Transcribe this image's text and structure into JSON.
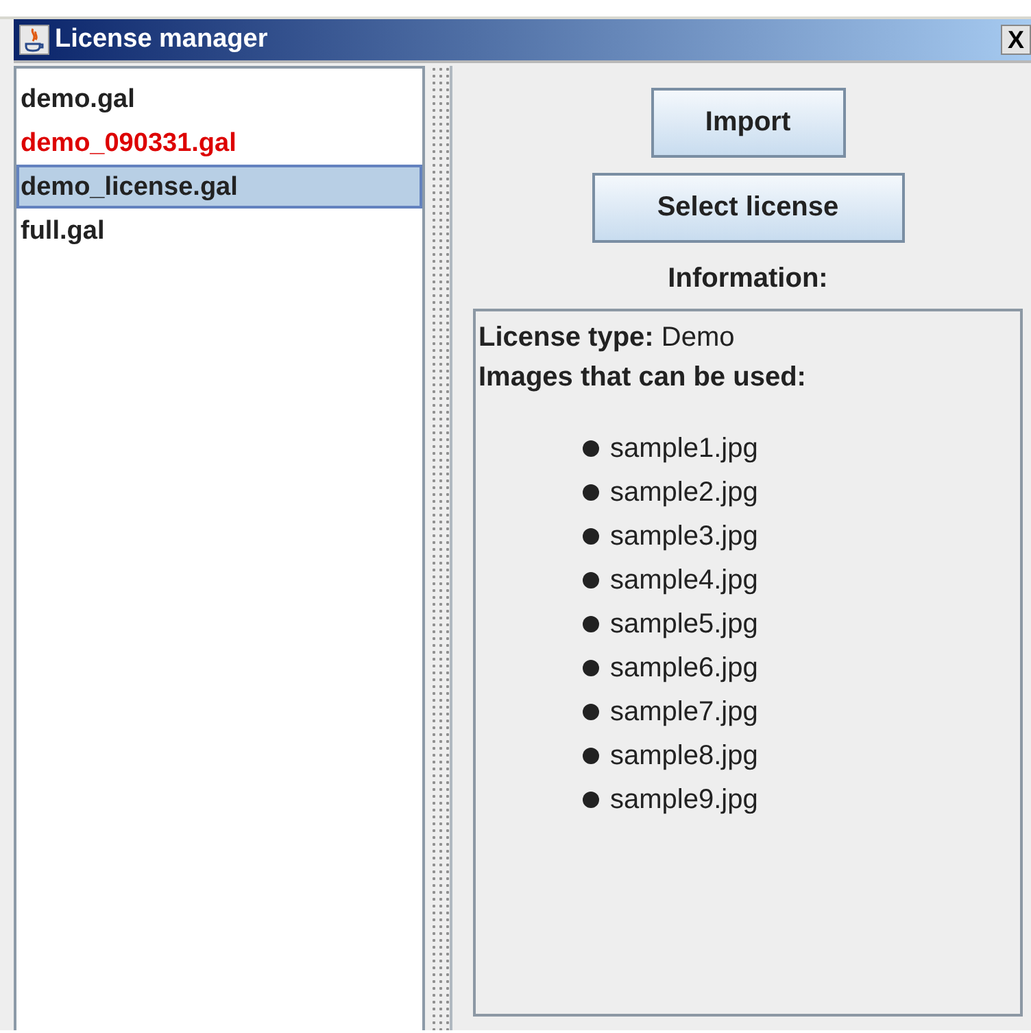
{
  "window": {
    "title": "License manager",
    "close": "X"
  },
  "files": [
    {
      "name": "demo.gal",
      "selected": false,
      "color": "#222222"
    },
    {
      "name": "demo_090331.gal",
      "selected": false,
      "color": "#dd0000"
    },
    {
      "name": "demo_license.gal",
      "selected": true,
      "color": "#222222"
    },
    {
      "name": "full.gal",
      "selected": false,
      "color": "#222222"
    }
  ],
  "buttons": [
    "Import",
    "Select license"
  ],
  "information": {
    "heading": "Information:",
    "license_type_label": "License type:",
    "license_type": "Demo",
    "images_label": "Images that can be used:",
    "images": [
      "sample1.jpg",
      "sample2.jpg",
      "sample3.jpg",
      "sample4.jpg",
      "sample5.jpg",
      "sample6.jpg",
      "sample7.jpg",
      "sample8.jpg",
      "sample9.jpg"
    ]
  }
}
